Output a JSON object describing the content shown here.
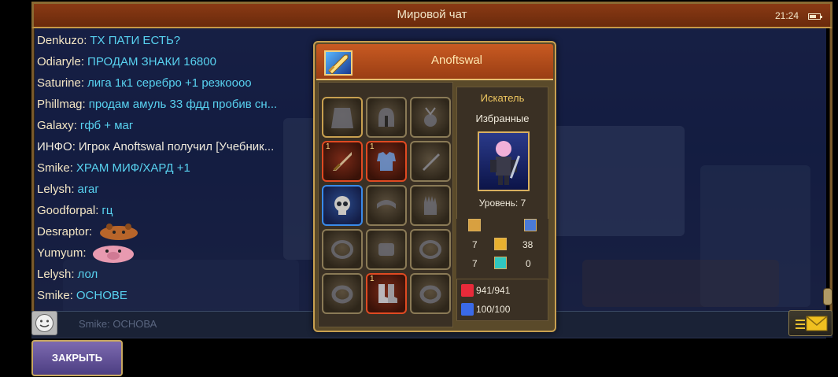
{
  "chat": {
    "title": "Мировой чат",
    "clock": "21:24",
    "messages": [
      {
        "author": "Denkuzo",
        "text": "ТХ ПАТИ ЕСТЬ?",
        "type": "normal"
      },
      {
        "author": "Odiaryle",
        "text": "ПРОДАМ ЗНАКИ 16800",
        "type": "normal"
      },
      {
        "author": "Saturine",
        "text": "лига 1к1 серебро +1 резкоооо",
        "type": "normal"
      },
      {
        "author": "Phillmag",
        "text": "продам амуль 33 фдд пробив сн...",
        "type": "normal"
      },
      {
        "author": "Galaxy",
        "text": "гфб + маг",
        "type": "normal"
      },
      {
        "author": "ИНФО",
        "text": "Игрок Anoftswal получил [Учебник...",
        "type": "info"
      },
      {
        "author": "Smike",
        "text": "ХРАМ МИФ/ХАРД +1",
        "type": "normal"
      },
      {
        "author": "Lelysh",
        "text": "агаг",
        "type": "normal"
      },
      {
        "author": "Goodforpal",
        "text": "гц",
        "type": "normal"
      },
      {
        "author": "Desraptor",
        "text": "",
        "type": "emoji",
        "emoji": "bear-emoji"
      },
      {
        "author": "Yumyum",
        "text": "",
        "type": "emoji",
        "emoji": "pig-emoji"
      },
      {
        "author": "Lelysh",
        "text": "лол",
        "type": "normal"
      },
      {
        "author": "Smike",
        "text": "ОСНОВЕ",
        "type": "normal"
      }
    ],
    "input_preview": "Ѕmike: ОСНОВА",
    "close_label": "ЗАКРЫТЬ"
  },
  "inspect": {
    "player_name": "Anoftswal",
    "class_name": "Искатель",
    "guild_name": "Избранные",
    "level_label": "Уровень: 7",
    "stats": {
      "attack": "7",
      "agility": "38",
      "defense": "7",
      "spirit": "0"
    },
    "hp": "941/941",
    "mp": "100/100",
    "equipment": [
      {
        "name": "cape-icon",
        "rarity": "common",
        "level": ""
      },
      {
        "name": "helmet-icon",
        "rarity": "default",
        "level": ""
      },
      {
        "name": "amulet-icon",
        "rarity": "default",
        "level": ""
      },
      {
        "name": "sword-icon",
        "rarity": "epic",
        "level": "1"
      },
      {
        "name": "armor-icon",
        "rarity": "epic",
        "level": "1"
      },
      {
        "name": "offhand-sword-icon",
        "rarity": "default",
        "level": ""
      },
      {
        "name": "skull-icon",
        "rarity": "rare",
        "level": ""
      },
      {
        "name": "belt-icon",
        "rarity": "default",
        "level": ""
      },
      {
        "name": "glove-icon",
        "rarity": "default",
        "level": ""
      },
      {
        "name": "bracelet-icon",
        "rarity": "default",
        "level": ""
      },
      {
        "name": "gauntlet-icon",
        "rarity": "default",
        "level": ""
      },
      {
        "name": "bracelet-icon",
        "rarity": "default",
        "level": ""
      },
      {
        "name": "ring-icon",
        "rarity": "default",
        "level": ""
      },
      {
        "name": "boots-icon",
        "rarity": "epic",
        "level": "1"
      },
      {
        "name": "ring-icon",
        "rarity": "default",
        "level": ""
      }
    ]
  },
  "colors": {
    "chat_text": "#58d2f0",
    "author": "#f4e6c4",
    "header": "#c85a22",
    "epic_border": "#e04a22",
    "rare_border": "#3a8ae8"
  }
}
